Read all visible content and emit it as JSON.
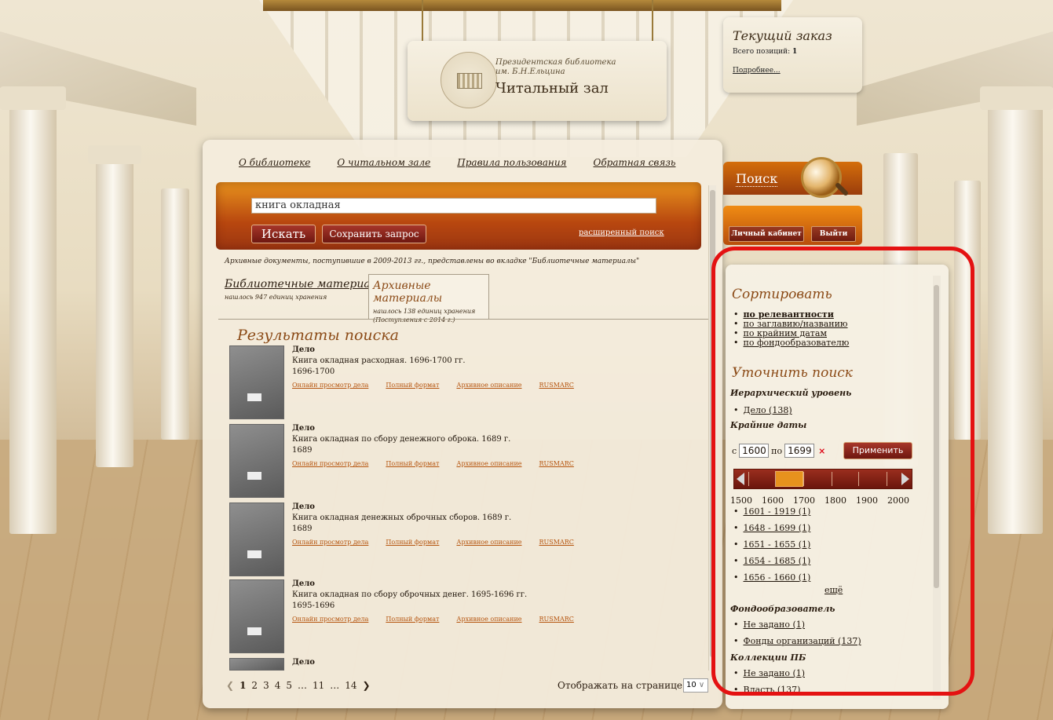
{
  "header": {
    "library_name_line1": "Президентская библиотека",
    "library_name_line2": "им. Б.Н.Ельцина",
    "hall_title": "Читальный зал"
  },
  "order": {
    "title": "Текущий заказ",
    "count_label": "Всего позиций:",
    "count_value": "1",
    "details_link": "Подробнее..."
  },
  "nav": {
    "about_library": "О библиотеке",
    "about_hall": "О читальном зале",
    "rules": "Правила пользования",
    "feedback": "Обратная связь"
  },
  "search": {
    "query": "книга окладная",
    "submit_label": "Искать",
    "save_label": "Сохранить запрос",
    "advanced_link": "расширенный поиск",
    "tab_label": "Поиск"
  },
  "account": {
    "cabinet_label": "Личный кабинет",
    "logout_label": "Выйти"
  },
  "notice": "Архивные документы, поступившие в 2009-2013 гг., представлены во вкладке \"Библиотечные материалы\"",
  "tabs": [
    {
      "title": "Библиотечные материалы",
      "subtitle": "нашлось 947 единиц хранения",
      "note": ""
    },
    {
      "title": "Архивные материалы",
      "subtitle": "нашлось 138 единиц хранения",
      "note": "(Поступления с 2014 г.)"
    }
  ],
  "results": {
    "heading": "Результаты поиска",
    "link_view": "Онлайн просмотр дела",
    "link_full": "Полный формат",
    "link_archive": "Архивное описание",
    "link_rusmarc": "RUSMARC",
    "items": [
      {
        "kind": "Дело",
        "title": "Книга окладная расходная. 1696-1700 гг.",
        "years": "1696-1700"
      },
      {
        "kind": "Дело",
        "title": "Книга окладная по сбору денежного оброка. 1689 г.",
        "years": "1689"
      },
      {
        "kind": "Дело",
        "title": "Книга окладная денежных оброчных сборов. 1689 г.",
        "years": "1689"
      },
      {
        "kind": "Дело",
        "title": "Книга окладная по сбору оброчных денег. 1695-1696 гг.",
        "years": "1695-1696"
      },
      {
        "kind": "Дело",
        "title": "",
        "years": ""
      }
    ]
  },
  "pager": {
    "pages": [
      "1",
      "2",
      "3",
      "4",
      "5",
      "…",
      "11",
      "…",
      "14"
    ],
    "current": "1",
    "per_page_label": "Отображать на странице",
    "per_page_value": "10"
  },
  "sidebar": {
    "sort_title": "Сортировать",
    "sort_options": [
      "по релевантности",
      "по заглавию/названию",
      "по крайним датам",
      "по фондообразователю"
    ],
    "refine_title": "Уточнить поиск",
    "level_title": "Иерархический уровень",
    "level_items": [
      "Дело (138)"
    ],
    "dates_title": "Крайние даты",
    "date_from_label": "с",
    "date_from": "1600",
    "date_to_label": "по",
    "date_to": "1699",
    "clear_symbol": "×",
    "apply_label": "Применить",
    "scale": [
      "1500",
      "1600",
      "1700",
      "1800",
      "1900",
      "2000"
    ],
    "date_items": [
      "1601 - 1919 (1)",
      "1648 - 1699 (1)",
      "1651 - 1655 (1)",
      "1654 - 1685 (1)",
      "1656 - 1660 (1)"
    ],
    "more_label": "ещё",
    "founder_title": "Фондообразователь",
    "founder_items": [
      "Не задано (1)",
      "Фонды организаций (137)"
    ],
    "collections_title": "Коллекции ПБ",
    "collection_items": [
      "Не задано (1)",
      "Власть (137)"
    ]
  },
  "colors": {
    "accent_orange": "#e7921d",
    "heading_brown": "#8b4a16",
    "button_red": "#8a2619",
    "highlight_red": "#e41212"
  }
}
